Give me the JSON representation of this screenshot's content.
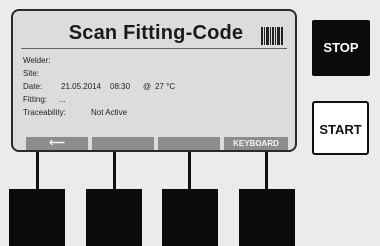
{
  "screen": {
    "title": "Scan Fitting-Code",
    "title_icon": "barcode-icon",
    "fields": {
      "welder_label": "Welder:",
      "site_label": "Site:",
      "date_label": "Date:",
      "date_value": "21.05.2014",
      "time_value": "08:30",
      "at_symbol": "@",
      "temperature_value": "27 °C",
      "fitting_label": "Fitting:",
      "fitting_value": "...",
      "traceability_label": "Traceability:",
      "traceability_value": "Not Active"
    },
    "softkeys": [
      {
        "label": "⟵",
        "icon": "back-arrow-icon"
      },
      {
        "label": ""
      },
      {
        "label": ""
      },
      {
        "label": "KEYBOARD"
      }
    ]
  },
  "buttons": {
    "stop_label": "STOP",
    "start_label": "START"
  },
  "colors": {
    "screen_bg": "#dcdcdc",
    "softkey_bg": "#8d8d8d",
    "hardware_key": "#0b0b0b",
    "start_bg": "#ffffff"
  }
}
